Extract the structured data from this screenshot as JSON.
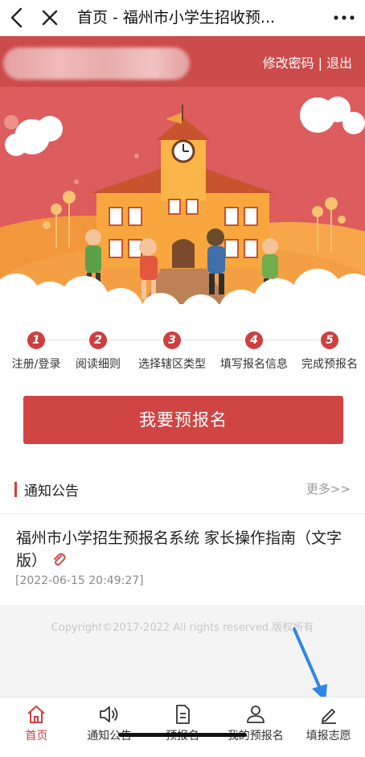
{
  "topbar": {
    "title": "首页 - 福州市小学生招收预..."
  },
  "userbar": {
    "change_password": "修改密码",
    "separator": "|",
    "logout": "退出"
  },
  "steps": [
    {
      "num": "1",
      "label": "注册/登录"
    },
    {
      "num": "2",
      "label": "阅读细则"
    },
    {
      "num": "3",
      "label": "选择辖区类型"
    },
    {
      "num": "4",
      "label": "填写报名信息"
    },
    {
      "num": "5",
      "label": "完成预报名"
    }
  ],
  "main_button": {
    "label": "我要预报名"
  },
  "notices": {
    "title": "通知公告",
    "more": "更多>>",
    "items": [
      {
        "title": "福州市小学招生预报名系统 家长操作指南（文字版）",
        "date": "[2022-06-15 20:49:27]"
      }
    ]
  },
  "footer": {
    "copyright": "Copyright©2017-2022 All rights reserved.版权所有"
  },
  "tabbar": [
    {
      "label": "首页",
      "icon": "home-icon",
      "active": true
    },
    {
      "label": "通知公告",
      "icon": "speaker-icon"
    },
    {
      "label": "预报名",
      "icon": "document-icon"
    },
    {
      "label": "我的预报名",
      "icon": "user-icon"
    },
    {
      "label": "填报志愿",
      "icon": "pencil-icon"
    }
  ],
  "colors": {
    "primary_red": "#cf4544",
    "userbar_red": "#cc4b4b",
    "annotation_blue": "#2f86e8"
  }
}
